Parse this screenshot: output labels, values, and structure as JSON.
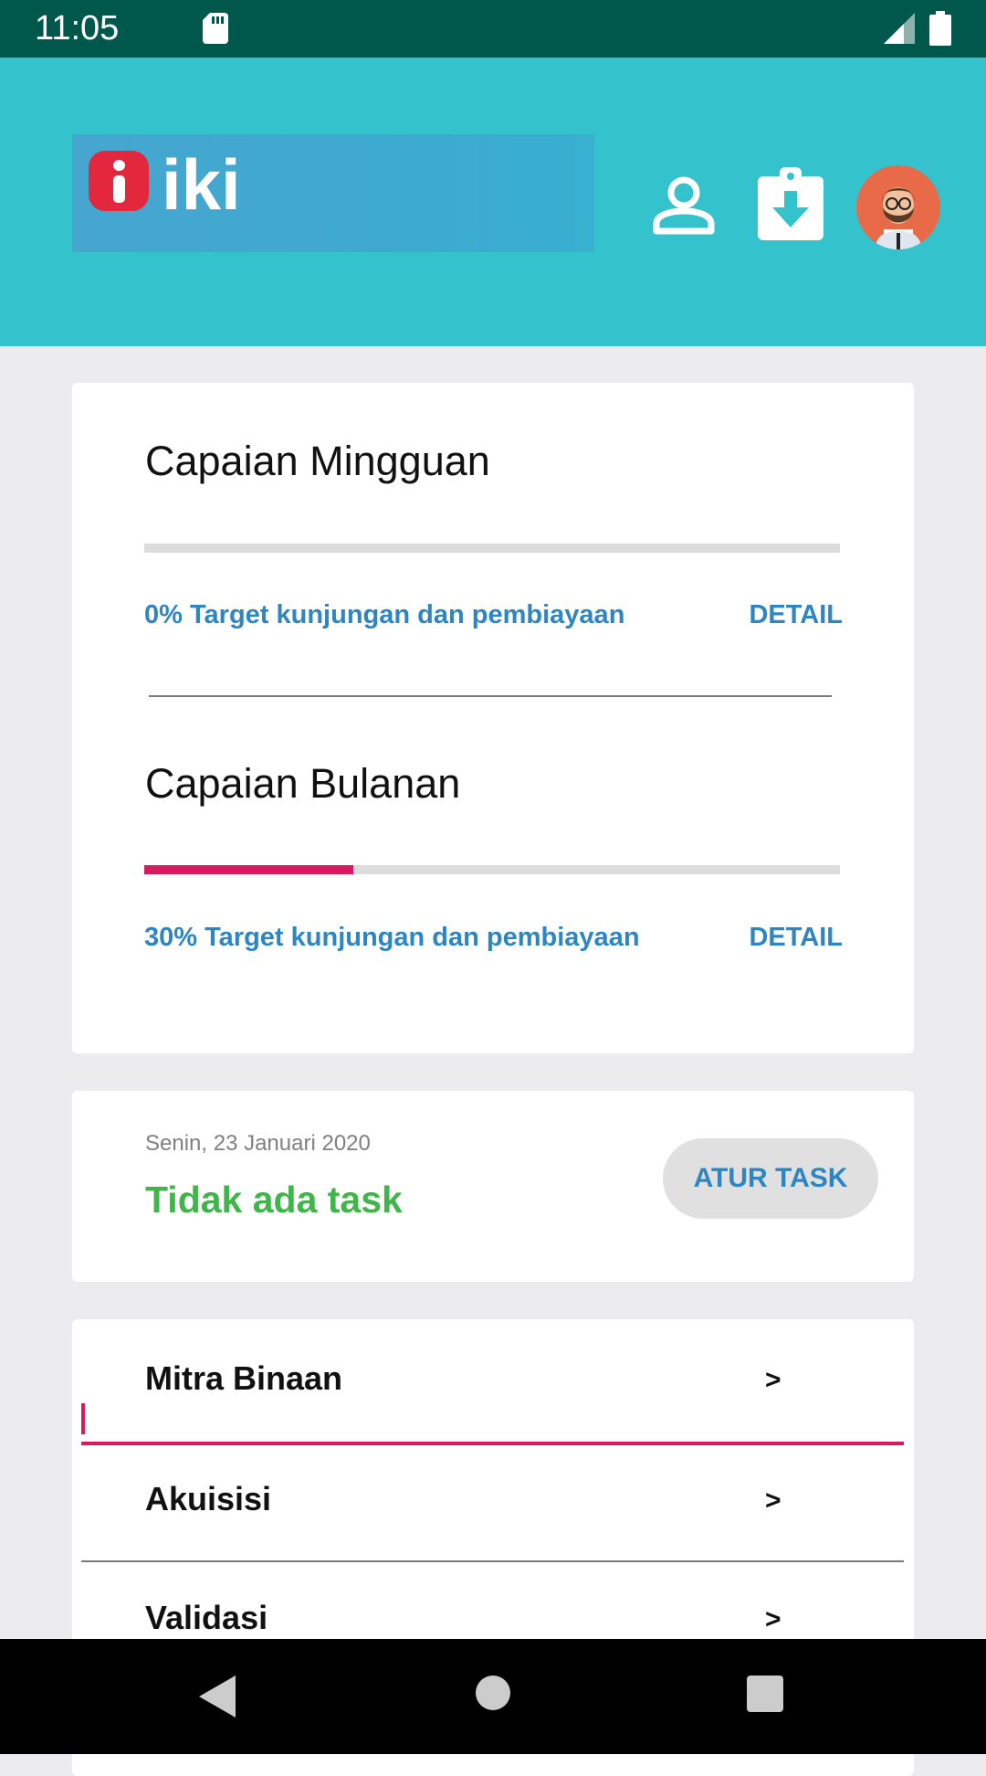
{
  "status_bar": {
    "time": "11:05"
  },
  "header": {
    "logo_text": "iki",
    "icons": [
      "profile-icon",
      "download-icon",
      "avatar"
    ],
    "background": "#34c2cc"
  },
  "weekly": {
    "title": "Capaian Mingguan",
    "progress": 0,
    "progress_text": "0% Target kunjungan dan pembiayaan",
    "detail_label": "DETAIL"
  },
  "monthly": {
    "title": "Capaian Bulanan",
    "progress": 0.3,
    "progress_text": "30% Target kunjungan dan pembiayaan",
    "detail_label": "DETAIL"
  },
  "task": {
    "date": "Senin, 23 Januari 2020",
    "status": "Tidak ada task",
    "button_label": "ATUR TASK"
  },
  "menu": {
    "items": [
      {
        "label": "Mitra Binaan",
        "arrow": ">"
      },
      {
        "label": "Akuisisi",
        "arrow": ">"
      },
      {
        "label": "Validasi",
        "arrow": ">"
      }
    ]
  },
  "colors": {
    "accent": "#d81b60",
    "link": "#2d86c2",
    "success": "#3fb54a",
    "status_bar": "#00584d"
  },
  "nav_bar": {
    "icons": [
      "back-icon",
      "home-icon",
      "recents-icon"
    ]
  }
}
